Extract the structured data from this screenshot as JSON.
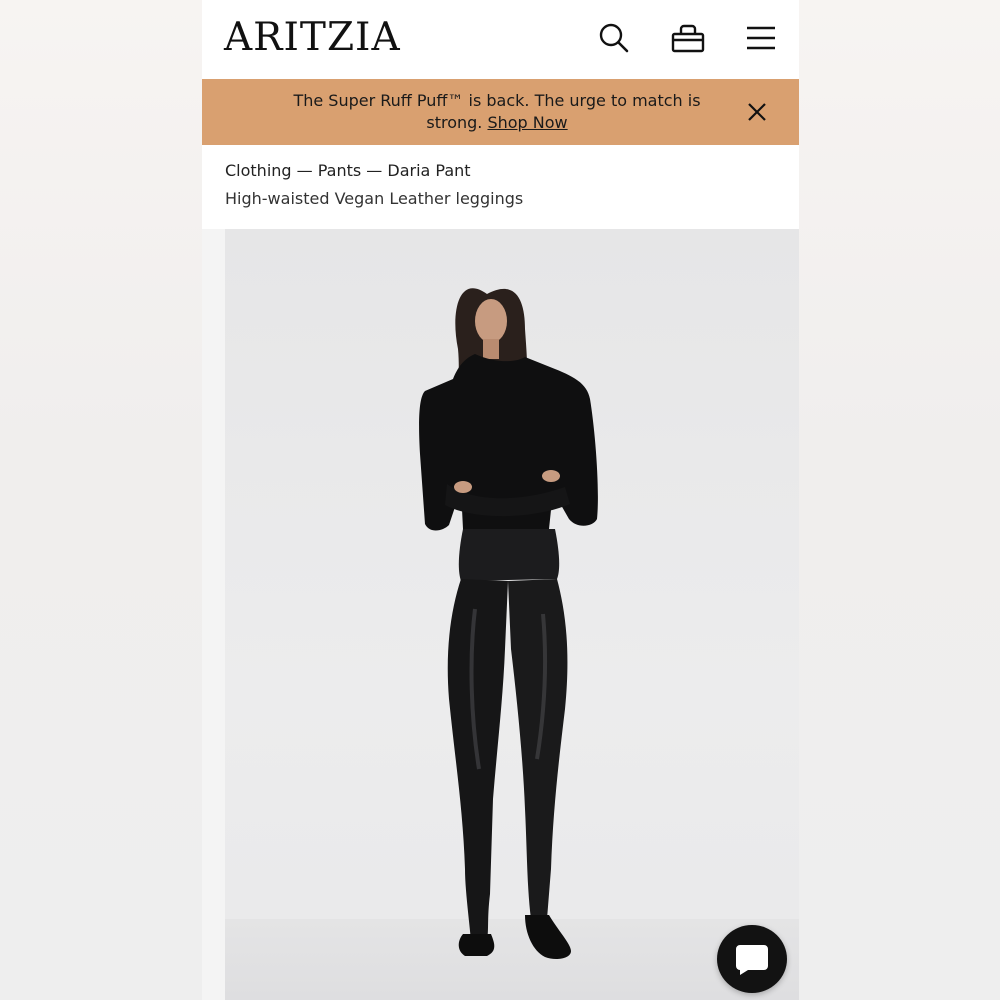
{
  "header": {
    "logo": "ARITZIA",
    "icons": [
      "search-icon",
      "shopping-bag-icon",
      "hamburger-menu-icon"
    ]
  },
  "promo": {
    "text": "The Super Ruff Puff™ is back. The urge to match is strong.",
    "link": "Shop Now",
    "background": "#d9a070"
  },
  "breadcrumb": {
    "path": "Clothing — Pants — Daria Pant",
    "subtitle": "High-waisted Vegan Leather leggings"
  },
  "product_image": {
    "subject": "model wearing black turtleneck and black vegan leather leggings"
  },
  "chat": {
    "icon": "chat-bubble-icon",
    "color": "#121212"
  }
}
